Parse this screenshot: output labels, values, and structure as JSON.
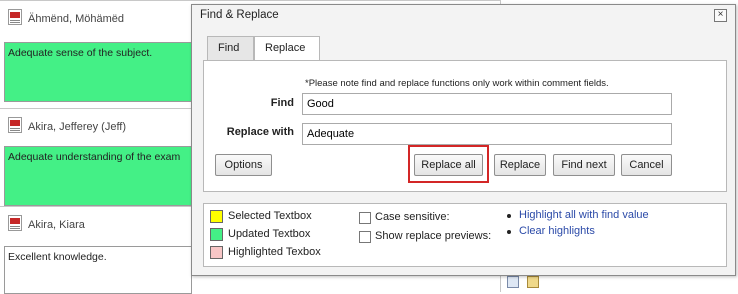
{
  "students": [
    {
      "name": "Ähmënd, Möhämëd"
    },
    {
      "name": "Akira, Jefferey (Jeff)"
    },
    {
      "name": "Akira, Kiara"
    }
  ],
  "comments": [
    {
      "text": "Adequate sense of the subject.",
      "state": "updated"
    },
    {
      "text": "Adequate understanding of the exam",
      "state": "updated"
    },
    {
      "text": "Excellent knowledge.",
      "state": "plain"
    }
  ],
  "dialog": {
    "title": "Find & Replace",
    "close_label": "×",
    "tabs": [
      {
        "label": "Find",
        "active": false
      },
      {
        "label": "Replace",
        "active": true
      }
    ],
    "note": "*Please note find and replace functions only work within comment fields.",
    "find_label": "Find",
    "find_value": "Good",
    "replace_label": "Replace with",
    "replace_value": "Adequate",
    "buttons": {
      "options": "Options",
      "replace_all": "Replace all",
      "replace": "Replace",
      "find_next": "Find next",
      "cancel": "Cancel"
    },
    "legend": [
      {
        "label": "Selected Textbox",
        "color": "#ffff00"
      },
      {
        "label": "Updated Textbox",
        "color": "#44f086"
      },
      {
        "label": "Highlighted Texbox",
        "color": "#f7c6c6"
      }
    ],
    "checkboxes": [
      {
        "label": "Case sensitive:",
        "checked": false
      },
      {
        "label": "Show replace previews:",
        "checked": false
      }
    ],
    "links": [
      {
        "label": "Highlight all with find value"
      },
      {
        "label": "Clear highlights"
      }
    ]
  },
  "colors": {
    "updated": "#44f086",
    "highlight_border": "#d32626",
    "link": "#2b4aa8"
  }
}
